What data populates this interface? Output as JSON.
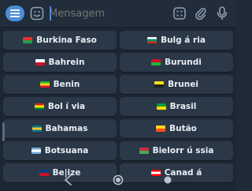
{
  "input": {
    "placeholder": "Mensagem"
  },
  "icons": {
    "menu": "menu-icon",
    "emoji": "emoji-icon",
    "keyboard": "keyboard-icon",
    "attach": "paperclip-icon",
    "mic": "microphone-icon"
  },
  "colors": {
    "accent": "#4c8ed6",
    "key_bg": "#2b3848",
    "bar_bg": "#212d3b",
    "keyboard_bg": "#1d2733"
  },
  "keys": [
    {
      "label": "Burkina Faso",
      "flag": [
        "#e4322b",
        "#1f9e4a"
      ]
    },
    {
      "label": "Bulg á ria",
      "flag": [
        "#ffffff",
        "#00966e",
        "#d62612"
      ]
    },
    {
      "label": "Bahrein",
      "flag": [
        "#ffffff",
        "#ce1126"
      ]
    },
    {
      "label": "Burundi",
      "flag": [
        "#ce1126",
        "#1eb53a"
      ]
    },
    {
      "label": "Benin",
      "flag": [
        "#1eb53a",
        "#fcd116",
        "#e8112d"
      ]
    },
    {
      "label": "Brunei",
      "flag": [
        "#f7e017",
        "#222222"
      ]
    },
    {
      "label": "Bol í via",
      "flag": [
        "#d52b1e",
        "#f9e300",
        "#007934"
      ]
    },
    {
      "label": "Brasil",
      "flag": [
        "#009c3b",
        "#ffdf00"
      ]
    },
    {
      "label": "Bahamas",
      "flag": [
        "#00778b",
        "#ffc72c",
        "#00778b"
      ]
    },
    {
      "label": "Butão",
      "flag": [
        "#ffd520",
        "#ff4e12"
      ]
    },
    {
      "label": "Botsuana",
      "flag": [
        "#75aadb",
        "#ffffff",
        "#75aadb"
      ]
    },
    {
      "label": "Bielorr ú ssia",
      "flag": [
        "#c8313e",
        "#4aa657"
      ]
    },
    {
      "label": "Be|ize",
      "flag": [
        "#003f87",
        "#ce1126"
      ]
    },
    {
      "label": "Canad á",
      "flag": [
        "#ff0000",
        "#ffffff",
        "#ff0000"
      ]
    }
  ],
  "nav": {
    "back": "back-icon",
    "home": "home-icon",
    "recents": "recents-icon"
  }
}
